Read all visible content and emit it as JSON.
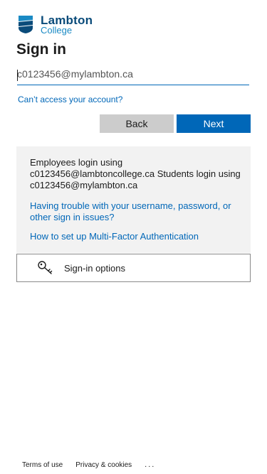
{
  "brand": {
    "name_top": "Lambton",
    "name_bottom": "College",
    "colors": {
      "dark_blue": "#0a4b7a",
      "light_blue": "#1a8ac4"
    },
    "icon": "lambton-shield-logo"
  },
  "page": {
    "title": "Sign in"
  },
  "login": {
    "input_value": "c0123456@mylambton.ca",
    "cant_access_link": "Can’t access your account?"
  },
  "buttons": {
    "back": "Back",
    "next": "Next"
  },
  "info": {
    "text": "Employees login using c0123456@lambtoncollege.ca Students login using c0123456@mylambton.ca",
    "trouble_link": "Having trouble with your username, password, or other sign in issues?",
    "mfa_link": "How to set up Multi-Factor Authentication"
  },
  "signin_options": {
    "label": "Sign-in options",
    "icon": "key-icon"
  },
  "footer": {
    "terms": "Terms of use",
    "privacy": "Privacy & cookies",
    "more": "..."
  },
  "accent_color": "#0067b8"
}
